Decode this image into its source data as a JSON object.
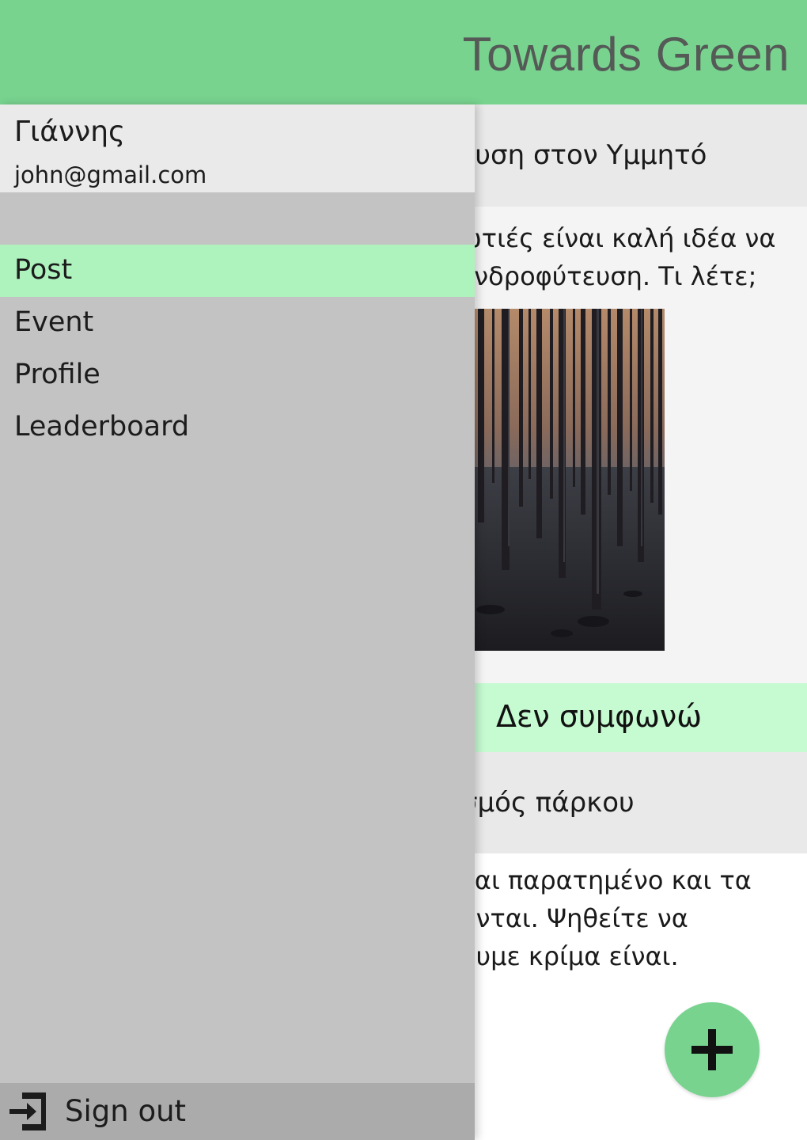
{
  "app_bar": {
    "title": "Towards Green",
    "color": "#78d38f"
  },
  "feed": {
    "posts": [
      {
        "title": "Δενδροφύτευση στον Υμμητό",
        "body_lines": [
          "Μετά τις πυρκαγιές είναι καλή ιδέα να",
          "οργανώσουμε δενδροφύτευση. Τι λέτε;"
        ],
        "visible_title": "ευση στον Υμμητό",
        "visible_body_lines": [
          "ωτιές είναι καλή ιδέα να",
          "ενδροφύτευση. Τι λέτε;"
        ],
        "image": "burnt-forest-photo",
        "vote_label": "Δεν συμφωνώ"
      },
      {
        "visible_title": "σμός πάρκου",
        "visible_body_lines": [
          "ναι παρατημένο και τα",
          "ονται. Ψηθείτε να",
          "ουμε κρίμα είναι."
        ]
      }
    ]
  },
  "drawer": {
    "user": {
      "name": "Γιάννης",
      "email": "john@gmail.com"
    },
    "menu": [
      {
        "label": "Post",
        "active": true
      },
      {
        "label": "Event",
        "active": false
      },
      {
        "label": "Profile",
        "active": false
      },
      {
        "label": "Leaderboard",
        "active": false
      }
    ],
    "sign_out": {
      "label": "Sign out",
      "icon": "sign-out-icon"
    }
  },
  "fab": {
    "icon": "plus-icon",
    "color": "#78d38f"
  },
  "colors": {
    "accent": "#78d38f",
    "active_menu": "#aef2bd",
    "vote_bar": "#c6fbd1",
    "drawer_bg": "#c3c3c3"
  }
}
